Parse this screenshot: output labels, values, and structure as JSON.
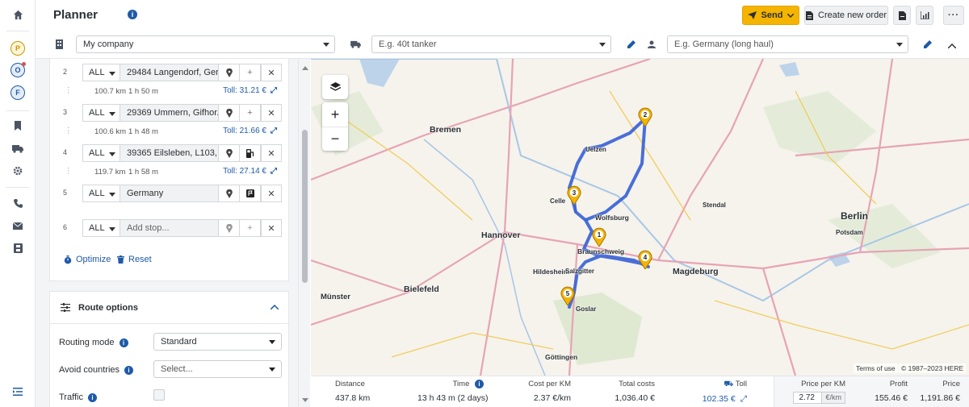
{
  "app": {
    "title": "Planner"
  },
  "rail": {
    "avatars": [
      {
        "letter": "P",
        "color": "#c99400",
        "bg": "#fff6d8"
      },
      {
        "letter": "O",
        "color": "#1e5aa8",
        "bg": "#e4ecf7"
      },
      {
        "letter": "F",
        "color": "#1e5aa8",
        "bg": "#e4ecf7"
      }
    ]
  },
  "header": {
    "send_label": "Send",
    "create_order_label": "Create new order"
  },
  "toolbar": {
    "company_value": "My company",
    "vehicle_placeholder": "E.g. 40t tanker",
    "profile_placeholder": "E.g. Germany (long haul)"
  },
  "stops": [
    {
      "number": "2",
      "type": "ALL",
      "address": "29484 Langendorf, Ger...",
      "tool": "pin"
    },
    {
      "number": "3",
      "type": "ALL",
      "address": "29369 Ummern, Gifhor...",
      "tool": "pin"
    },
    {
      "number": "4",
      "type": "ALL",
      "address": "39365 Eilsleben, L103, ...",
      "tool": "fuel"
    },
    {
      "number": "5",
      "type": "ALL",
      "address": "Germany",
      "tool": "flag"
    },
    {
      "number": "6",
      "type": "ALL",
      "address": "",
      "placeholder": "Add stop...",
      "tool": "pin"
    }
  ],
  "legs": [
    {
      "distance": "100.7 km",
      "time": "1 h 50 m",
      "toll": "Toll: 31.21 €"
    },
    {
      "distance": "100.6 km",
      "time": "1 h 48 m",
      "toll": "Toll: 21.66 €"
    },
    {
      "distance": "119.7 km",
      "time": "1 h 58 m",
      "toll": "Toll: 27.14 €"
    }
  ],
  "actions": {
    "optimize": "Optimize",
    "reset": "Reset"
  },
  "route_options": {
    "title": "Route options",
    "routing_mode_label": "Routing mode",
    "routing_mode_value": "Standard",
    "avoid_countries_label": "Avoid countries",
    "avoid_countries_placeholder": "Select...",
    "traffic_label": "Traffic"
  },
  "map": {
    "markers": [
      "1",
      "2",
      "3",
      "4",
      "5"
    ],
    "cities": [
      "Bremen",
      "Hannover",
      "Bielefeld",
      "Magdeburg",
      "Berlin",
      "Wolfsburg",
      "Braunschweig",
      "Hildesheim",
      "Salzgitter",
      "Goslar",
      "Göttingen",
      "Münster",
      "Potsdam",
      "Celle",
      "Uelzen",
      "Stendal"
    ],
    "terms": "Terms of use",
    "copyright": "© 1987–2023 HERE"
  },
  "summary": {
    "distance_label": "Distance",
    "distance_value": "437.8 km",
    "time_label": "Time",
    "time_value": "13 h 43 m",
    "time_extra": "(2 days)",
    "cost_per_km_label": "Cost per KM",
    "cost_per_km_value": "2.37 €/km",
    "total_costs_label": "Total costs",
    "total_costs_value": "1,036.40 €",
    "toll_label": "Toll",
    "toll_value": "102.35 €",
    "price_per_km_label": "Price per KM",
    "price_per_km_value": "2.72",
    "price_per_km_unit": "€/km",
    "profit_label": "Profit",
    "profit_value": "155.46 €",
    "price_label": "Price",
    "price_value": "1,191.86 €"
  },
  "colors": {
    "accent": "#f5b400",
    "link": "#1e5aa8",
    "route": "#3b63d6"
  }
}
